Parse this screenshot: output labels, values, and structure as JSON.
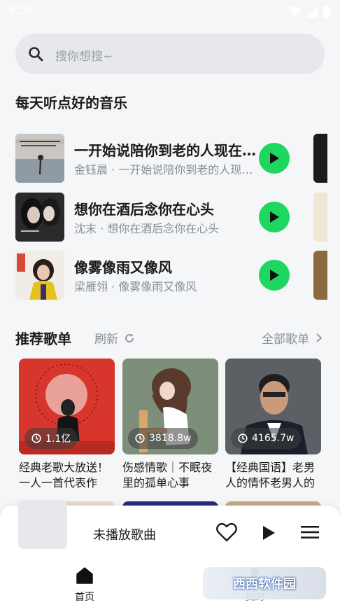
{
  "status_bar": {
    "time": "8:29"
  },
  "search": {
    "placeholder": "搜你想搜~"
  },
  "daily": {
    "title": "每天听点好的音乐",
    "songs": [
      {
        "title": "一开始说陪你到老的人现在在哪",
        "subtitle": "金钰晨 · 一开始说陪你到老的人现在在哪"
      },
      {
        "title": "想你在酒后念你在心头",
        "subtitle": "沈末 · 想你在酒后念你在心头"
      },
      {
        "title": "像雾像雨又像风",
        "subtitle": "梁雁翎 · 像雾像雨又像风"
      }
    ]
  },
  "recommend": {
    "title": "推荐歌单",
    "refresh_label": "刷新",
    "all_label": "全部歌单",
    "playlists": [
      {
        "count": "1.1亿",
        "name": "经典老歌大放送！一人一首代表作"
      },
      {
        "count": "3818.8w",
        "name": "伤感情歌｜不眠夜里的孤单心事"
      },
      {
        "count": "4165.7w",
        "name": "【经典国语】老男人的情怀老男人的歌"
      }
    ]
  },
  "player": {
    "now_playing": "未播放歌曲"
  },
  "tabs": [
    {
      "label": "首页"
    },
    {
      "label": "我的"
    }
  ],
  "watermark": {
    "text": "西西软件园"
  },
  "colors": {
    "accent": "#1ed760",
    "background": "#f4f6f8"
  }
}
